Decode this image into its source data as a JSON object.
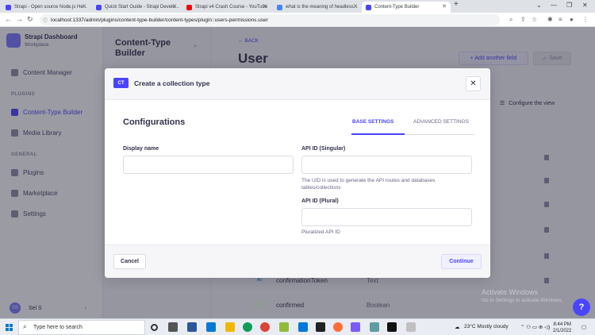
{
  "browser": {
    "tabs": [
      {
        "title": "Strapi - Open source Node.js He...",
        "favicon_color": "#4945ff"
      },
      {
        "title": "Quick Start Guide - Strapi Develo...",
        "favicon_color": "#4945ff"
      },
      {
        "title": "Strapi v4 Crash Course - YouTube",
        "favicon_color": "#ff0000"
      },
      {
        "title": "what is the meaning of headless...",
        "favicon_color": "#4285f4"
      },
      {
        "title": "Content-Type Builder",
        "favicon_color": "#4945ff"
      }
    ],
    "new_tab_icon": "plus-icon",
    "url": "localhost:1337/admin/plugins/content-type-builder/content-types/plugin::users-permissions.user"
  },
  "sidebar": {
    "brand_title": "Strapi Dashboard",
    "brand_subtitle": "Workplace",
    "items": [
      {
        "label": "Content Manager"
      },
      {
        "label": "Content-Type Builder"
      },
      {
        "label": "Media Library"
      },
      {
        "label": "Plugins"
      },
      {
        "label": "Marketplace"
      },
      {
        "label": "Settings"
      }
    ],
    "section_plugins": "PLUGINS",
    "section_general": "GENERAL",
    "user_initials": "SS",
    "user_name": "Sel S"
  },
  "ctb_panel": {
    "title": "Content-Type Builder"
  },
  "main": {
    "back_label": "BACK",
    "title": "User",
    "add_field_label": "+ Add another field",
    "save_label": "Save",
    "configure_label": "Configure the view",
    "fields": [
      {
        "icon": "Ab",
        "name": "confirmationToken",
        "type": "Text"
      },
      {
        "icon": "toggle",
        "name": "confirmed",
        "type": "Boolean"
      }
    ]
  },
  "modal": {
    "badge": "CT",
    "title": "Create a collection type",
    "section_title": "Configurations",
    "tab_base": "BASE SETTINGS",
    "tab_advanced": "ADVANCED SETTINGS",
    "display_name_label": "Display name",
    "display_name_value": "",
    "api_singular_label": "API ID (Singular)",
    "api_singular_value": "",
    "api_singular_hint": "The UID is used to generate the API routes and databases tables/collections",
    "api_plural_label": "API ID (Plural)",
    "api_plural_value": "",
    "api_plural_hint": "Pluralized API ID",
    "cancel_label": "Cancel",
    "continue_label": "Continue"
  },
  "windows_notice": {
    "line1": "Activate Windows",
    "line2": "Go to Settings to activate Windows."
  },
  "taskbar": {
    "search_placeholder": "Type here to search",
    "weather": "23°C  Mostly cloudy",
    "time": "8:44 PM",
    "date": "2/1/2022"
  }
}
